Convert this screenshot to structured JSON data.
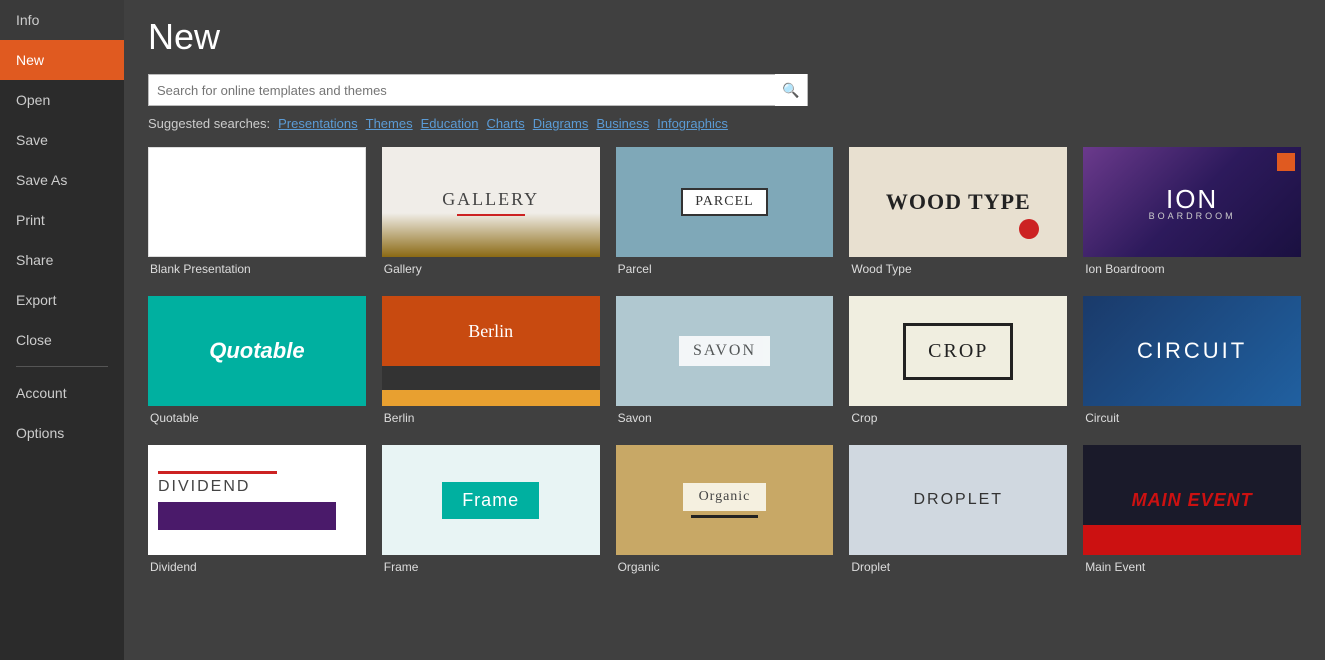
{
  "sidebar": {
    "items": [
      {
        "id": "info",
        "label": "Info",
        "active": false
      },
      {
        "id": "new",
        "label": "New",
        "active": true
      },
      {
        "id": "open",
        "label": "Open",
        "active": false
      },
      {
        "id": "save",
        "label": "Save",
        "active": false
      },
      {
        "id": "save-as",
        "label": "Save As",
        "active": false
      },
      {
        "id": "print",
        "label": "Print",
        "active": false
      },
      {
        "id": "share",
        "label": "Share",
        "active": false
      },
      {
        "id": "export",
        "label": "Export",
        "active": false
      },
      {
        "id": "close",
        "label": "Close",
        "active": false
      },
      {
        "id": "account",
        "label": "Account",
        "active": false
      },
      {
        "id": "options",
        "label": "Options",
        "active": false
      }
    ]
  },
  "page": {
    "title": "New"
  },
  "search": {
    "placeholder": "Search for online templates and themes",
    "button_icon": "🔍"
  },
  "suggested": {
    "label": "Suggested searches:",
    "links": [
      "Presentations",
      "Themes",
      "Education",
      "Charts",
      "Diagrams",
      "Business",
      "Infographics"
    ]
  },
  "templates": [
    {
      "id": "blank",
      "label": "Blank Presentation"
    },
    {
      "id": "gallery",
      "label": "Gallery"
    },
    {
      "id": "parcel",
      "label": "Parcel"
    },
    {
      "id": "wood-type",
      "label": "Wood Type"
    },
    {
      "id": "ion",
      "label": "Ion Boardroom"
    },
    {
      "id": "quotable",
      "label": "Quotable"
    },
    {
      "id": "berlin",
      "label": "Berlin"
    },
    {
      "id": "savon",
      "label": "Savon"
    },
    {
      "id": "crop",
      "label": "Crop"
    },
    {
      "id": "circuit",
      "label": "Circuit"
    },
    {
      "id": "dividend",
      "label": "Dividend"
    },
    {
      "id": "frame",
      "label": "Frame"
    },
    {
      "id": "organic",
      "label": "Organic"
    },
    {
      "id": "droplet",
      "label": "Droplet"
    },
    {
      "id": "main-event",
      "label": "Main Event"
    }
  ]
}
